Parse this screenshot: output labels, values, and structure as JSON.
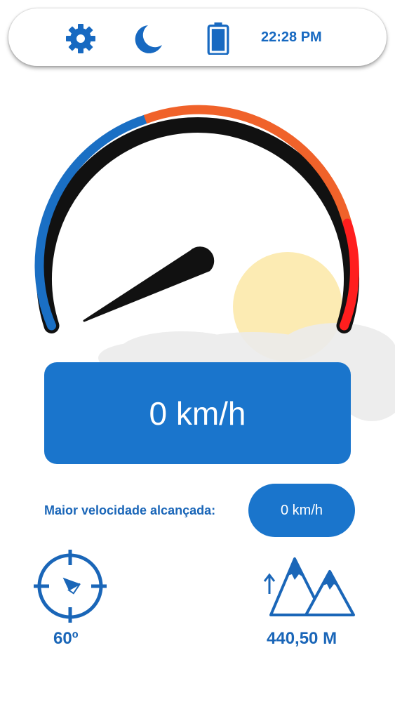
{
  "status_bar": {
    "icons": [
      "gear-icon",
      "moon-icon",
      "battery-icon"
    ],
    "time": "22:28 PM"
  },
  "speedometer": {
    "current_speed": "0 km/h",
    "needle_speed_kmh": 0,
    "arc_colors": [
      "#1a6fc4",
      "#f0622a",
      "#ff1e1e"
    ]
  },
  "max_speed": {
    "label": "Maior velocidade alcançada:",
    "value": "0 km/h"
  },
  "compass": {
    "icon": "compass-icon",
    "heading": "60º"
  },
  "altitude": {
    "icon": "mountain-icon",
    "value": "440,50 M"
  },
  "colors": {
    "primary": "#1a75cc",
    "text_blue": "#1a66b8"
  }
}
